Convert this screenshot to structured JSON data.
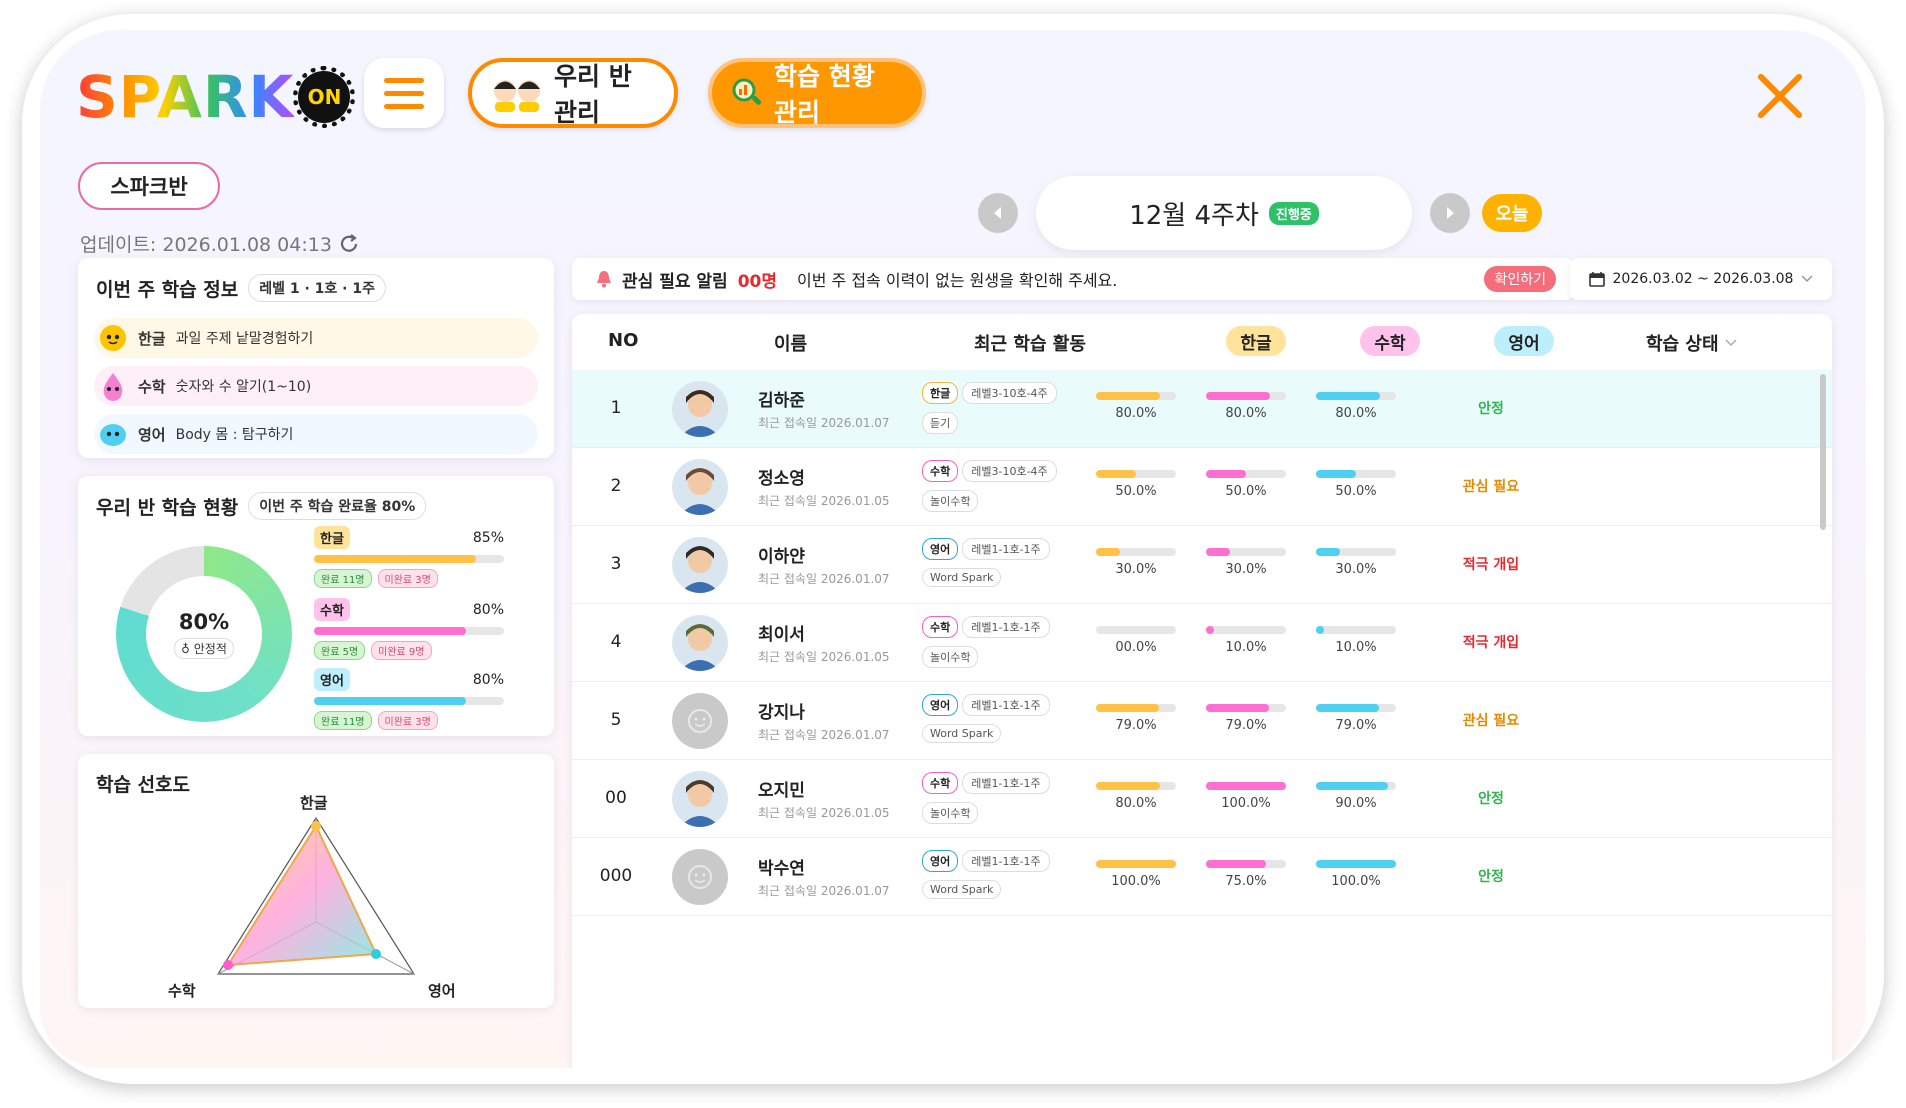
{
  "header": {
    "logo_text": "SPARK",
    "logo_badge": "ON",
    "nav_class": "우리 반 관리",
    "nav_status": "학습 현황 관리"
  },
  "class_name": "스파크반",
  "update_text": "업데이트: 2026.01.08 04:13",
  "week": {
    "label": "12월 4주차",
    "badge": "진행중",
    "today": "오늘"
  },
  "weekly_info": {
    "title": "이번 주 학습 정보",
    "chip": "레벨 1 · 1호 · 1주",
    "subjects": [
      {
        "name": "한글",
        "desc": "과일 주제 낱말경험하기"
      },
      {
        "name": "수학",
        "desc": "숫자와 수 알기(1~10)"
      },
      {
        "name": "영어",
        "desc": "Body 몸 : 탐구하기"
      }
    ]
  },
  "class_status": {
    "title": "우리 반 학습 현황",
    "chip": "이번 주 학습 완료율 80%",
    "donut_pct": "80%",
    "donut_value": 80,
    "donut_label": "안정적",
    "subjects": [
      {
        "name": "한글",
        "pct": "85%",
        "value": 85,
        "done": "완료 11명",
        "undone": "미완료 3명"
      },
      {
        "name": "수학",
        "pct": "80%",
        "value": 80,
        "done": "완료 5명",
        "undone": "미완료 9명"
      },
      {
        "name": "영어",
        "pct": "80%",
        "value": 80,
        "done": "완료 11명",
        "undone": "미완료 3명"
      }
    ]
  },
  "preference": {
    "title": "학습 선호도",
    "axes": [
      "한글",
      "수학",
      "영어"
    ]
  },
  "alert": {
    "title": "관심 필요 알림",
    "count": "00명",
    "message": "이번 주 접속 이력이 없는 원생을 확인해 주세요.",
    "button": "확인하기"
  },
  "date_range": "2026.03.02 ~ 2026.03.08",
  "table": {
    "headers": {
      "no": "NO",
      "name": "이름",
      "activity": "최근 학습 활동",
      "kor": "한글",
      "math": "수학",
      "eng": "영어",
      "status": "학습 상태"
    },
    "rows": [
      {
        "no": "1",
        "name": "김하준",
        "login": "최근 접속일 2026.01.07",
        "subject": "한글",
        "level": "레벨3-10호-4주",
        "sub": "듣기",
        "kor": "80.0%",
        "math": "80.0%",
        "eng": "80.0%",
        "kv": 80,
        "mv": 80,
        "ev": 80,
        "status": "안정"
      },
      {
        "no": "2",
        "name": "정소영",
        "login": "최근 접속일 2026.01.05",
        "subject": "수학",
        "level": "레벨3-10호-4주",
        "sub": "놀이수학",
        "kor": "50.0%",
        "math": "50.0%",
        "eng": "50.0%",
        "kv": 50,
        "mv": 50,
        "ev": 50,
        "status": "관심 필요"
      },
      {
        "no": "3",
        "name": "이하얀",
        "login": "최근 접속일 2026.01.07",
        "subject": "영어",
        "level": "레벨1-1호-1주",
        "sub": "Word Spark",
        "kor": "30.0%",
        "math": "30.0%",
        "eng": "30.0%",
        "kv": 30,
        "mv": 30,
        "ev": 30,
        "status": "적극 개입"
      },
      {
        "no": "4",
        "name": "최이서",
        "login": "최근 접속일 2026.01.05",
        "subject": "수학",
        "level": "레벨1-1호-1주",
        "sub": "놀이수학",
        "kor": "00.0%",
        "math": "10.0%",
        "eng": "10.0%",
        "kv": 0,
        "mv": 10,
        "ev": 10,
        "status": "적극 개입"
      },
      {
        "no": "5",
        "name": "강지나",
        "login": "최근 접속일 2026.01.07",
        "subject": "영어",
        "level": "레벨1-1호-1주",
        "sub": "Word Spark",
        "kor": "79.0%",
        "math": "79.0%",
        "eng": "79.0%",
        "kv": 79,
        "mv": 79,
        "ev": 79,
        "status": "관심 필요"
      },
      {
        "no": "00",
        "name": "오지민",
        "login": "최근 접속일 2026.01.05",
        "subject": "수학",
        "level": "레벨1-1호-1주",
        "sub": "놀이수학",
        "kor": "80.0%",
        "math": "100.0%",
        "eng": "90.0%",
        "kv": 80,
        "mv": 100,
        "ev": 90,
        "status": "안정"
      },
      {
        "no": "000",
        "name": "박수연",
        "login": "최근 접속일 2026.01.07",
        "subject": "영어",
        "level": "레벨1-1호-1주",
        "sub": "Word Spark",
        "kor": "100.0%",
        "math": "75.0%",
        "eng": "100.0%",
        "kv": 100,
        "mv": 75,
        "ev": 100,
        "status": "안정"
      }
    ]
  },
  "colors": {
    "accent": "#ff8a00",
    "kor": "#ffc246",
    "math": "#ff6fd1",
    "eng": "#4fd0f2",
    "stable": "#2fb44f",
    "attention": "#e58a00",
    "intervene": "#e8272d"
  }
}
